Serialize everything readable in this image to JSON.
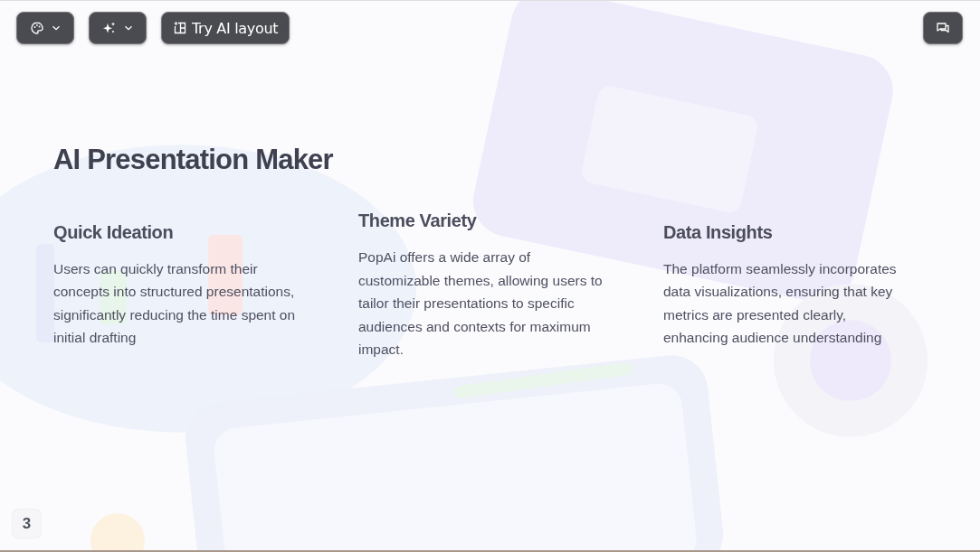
{
  "toolbar": {
    "theme_button": {
      "kind": "dropdown"
    },
    "ai_button": {
      "kind": "dropdown"
    },
    "layout_button": {
      "label": "Try AI layout"
    }
  },
  "slide": {
    "title": "AI Presentation Maker",
    "features": [
      {
        "heading": "Quick Ideation",
        "text": "Users can quickly transform their concepts into structured presentations, significantly reducing the time spent on initial drafting"
      },
      {
        "heading": "Theme Variety",
        "text": "PopAi offers a wide array of customizable themes, allowing users to tailor their presentations to specific audiences and contexts for maximum impact."
      },
      {
        "heading": "Data Insights",
        "text": "The platform seamlessly incorporates data visualizations, ensuring that key metrics are presented clearly, enhancing audience understanding"
      }
    ]
  },
  "page_number": "3"
}
